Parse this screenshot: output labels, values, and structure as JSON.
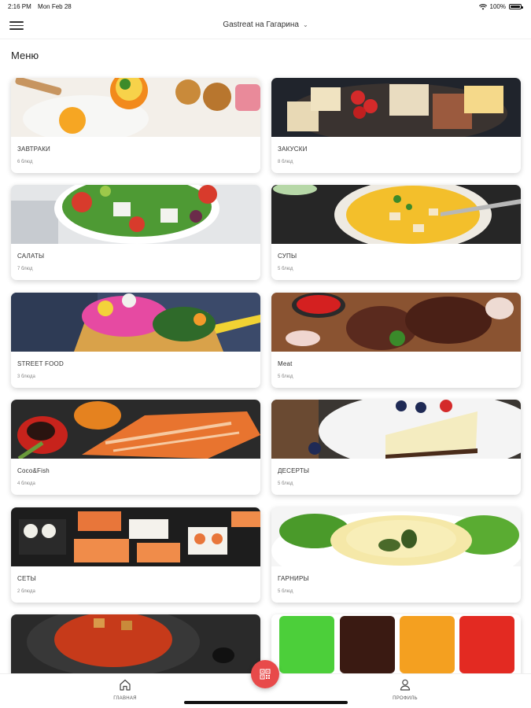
{
  "status": {
    "time": "2:16 PM",
    "date": "Mon Feb 28",
    "battery": "100%"
  },
  "header": {
    "venue": "Gastreat на Гагарина"
  },
  "page": {
    "title": "Меню"
  },
  "categories": [
    {
      "name": "ЗАВТРАКИ",
      "count": "6 блюд"
    },
    {
      "name": "ЗАКУСКИ",
      "count": "8 блюд"
    },
    {
      "name": "САЛАТЫ",
      "count": "7 блюд"
    },
    {
      "name": "СУПЫ",
      "count": "5 блюд"
    },
    {
      "name": "STREET FOOD",
      "count": "3 блюда"
    },
    {
      "name": "Meat",
      "count": "5 блюд"
    },
    {
      "name": "Coco&Fish",
      "count": "4 блюда"
    },
    {
      "name": "ДЕСЕРТЫ",
      "count": "5 блюд"
    },
    {
      "name": "СЕТЫ",
      "count": "2 блюда"
    },
    {
      "name": "ГАРНИРЫ",
      "count": "5 блюд"
    },
    {
      "name": "",
      "count": ""
    },
    {
      "name": "",
      "count": ""
    }
  ],
  "tabbar": {
    "home": "ГЛАВНАЯ",
    "profile": "ПРОФИЛЬ"
  },
  "colors": {
    "accent": "#e84a4a"
  }
}
